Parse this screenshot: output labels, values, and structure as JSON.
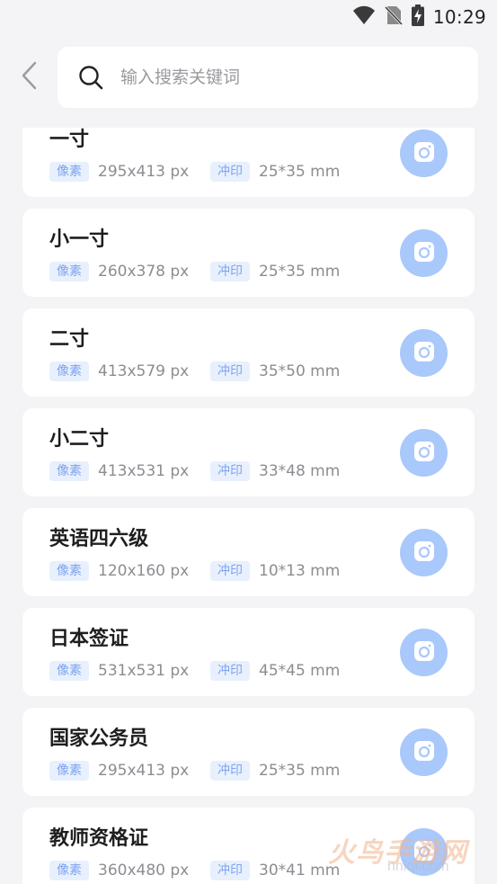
{
  "status_bar": {
    "time": "10:29",
    "icons": [
      "wifi-icon",
      "no-sim-icon",
      "battery-charging-icon"
    ]
  },
  "header": {
    "back_icon": "chevron-left-icon",
    "search": {
      "icon": "search-icon",
      "placeholder": "输入搜索关键词",
      "value": ""
    }
  },
  "labels": {
    "pixel_badge": "像素",
    "print_badge": "冲印"
  },
  "items": [
    {
      "title": "一寸",
      "pixels": "295x413 px",
      "print": "25*35 mm"
    },
    {
      "title": "小一寸",
      "pixels": "260x378 px",
      "print": "25*35 mm"
    },
    {
      "title": "二寸",
      "pixels": "413x579 px",
      "print": "35*50 mm"
    },
    {
      "title": "小二寸",
      "pixels": "413x531 px",
      "print": "33*48 mm"
    },
    {
      "title": "英语四六级",
      "pixels": "120x160 px",
      "print": "10*13 mm"
    },
    {
      "title": "日本签证",
      "pixels": "531x531 px",
      "print": "45*45 mm"
    },
    {
      "title": "国家公务员",
      "pixels": "295x413 px",
      "print": "25*35 mm"
    },
    {
      "title": "教师资格证",
      "pixels": "360x480 px",
      "print": "30*41 mm"
    }
  ],
  "watermark": {
    "text": "火鸟手游网",
    "url": "hniqi.com"
  },
  "colors": {
    "accent": "#a9c8fb",
    "badge_bg": "#e8f0fd",
    "badge_text": "#7da4ef",
    "page_bg": "#f4f4f6"
  }
}
